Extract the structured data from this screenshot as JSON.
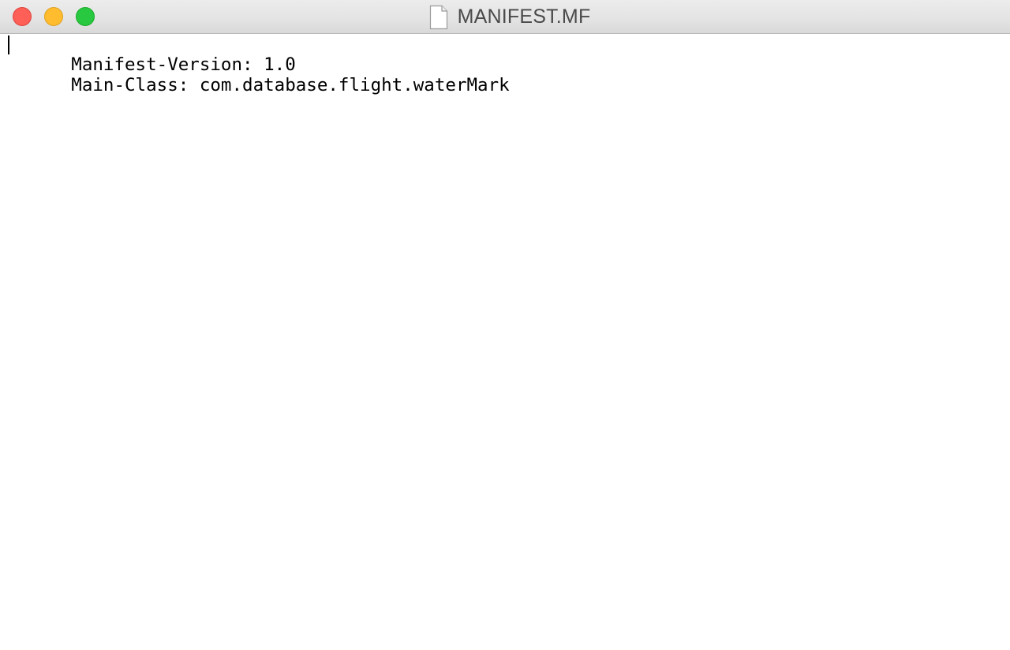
{
  "window": {
    "title": "MANIFEST.MF",
    "title_icon": "document-icon"
  },
  "traffic_lights": {
    "close_color": "#fe5f57",
    "minimize_color": "#febc2e",
    "zoom_color": "#28c840"
  },
  "editor": {
    "lines": [
      "Manifest-Version: 1.0",
      "Main-Class: com.database.flight.waterMark"
    ]
  }
}
